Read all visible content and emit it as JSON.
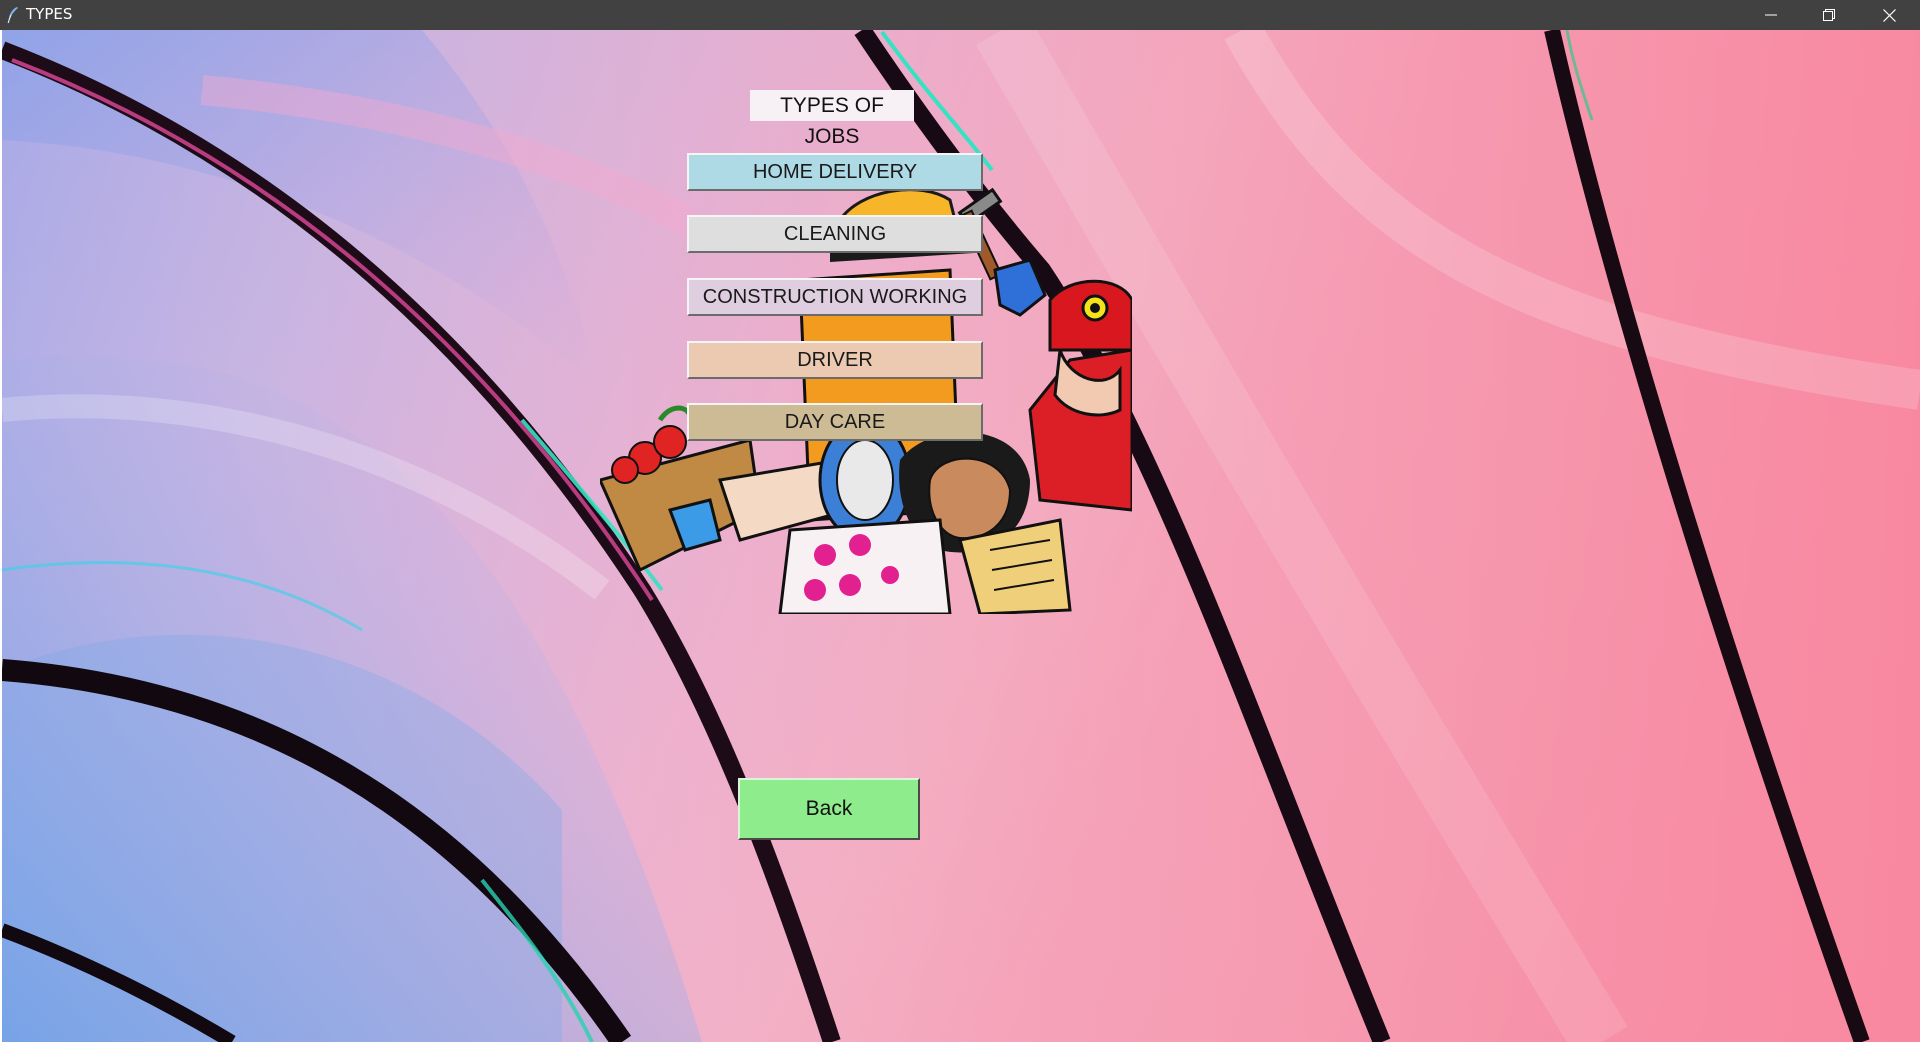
{
  "window": {
    "title": "TYPES"
  },
  "header": {
    "title": "TYPES OF JOBS"
  },
  "jobs": [
    {
      "label": "HOME DELIVERY",
      "color": "#aedae6"
    },
    {
      "label": "CLEANING",
      "color": "#dedede"
    },
    {
      "label": "CONSTRUCTION WORKING",
      "color": "#dfcde0"
    },
    {
      "label": "DRIVER",
      "color": "#ecc9b1"
    },
    {
      "label": "DAY CARE",
      "color": "#cdbb96"
    }
  ],
  "back_button": {
    "label": "Back",
    "color": "#8eec8d"
  },
  "illustration": {
    "icon": "workers-illustration"
  }
}
